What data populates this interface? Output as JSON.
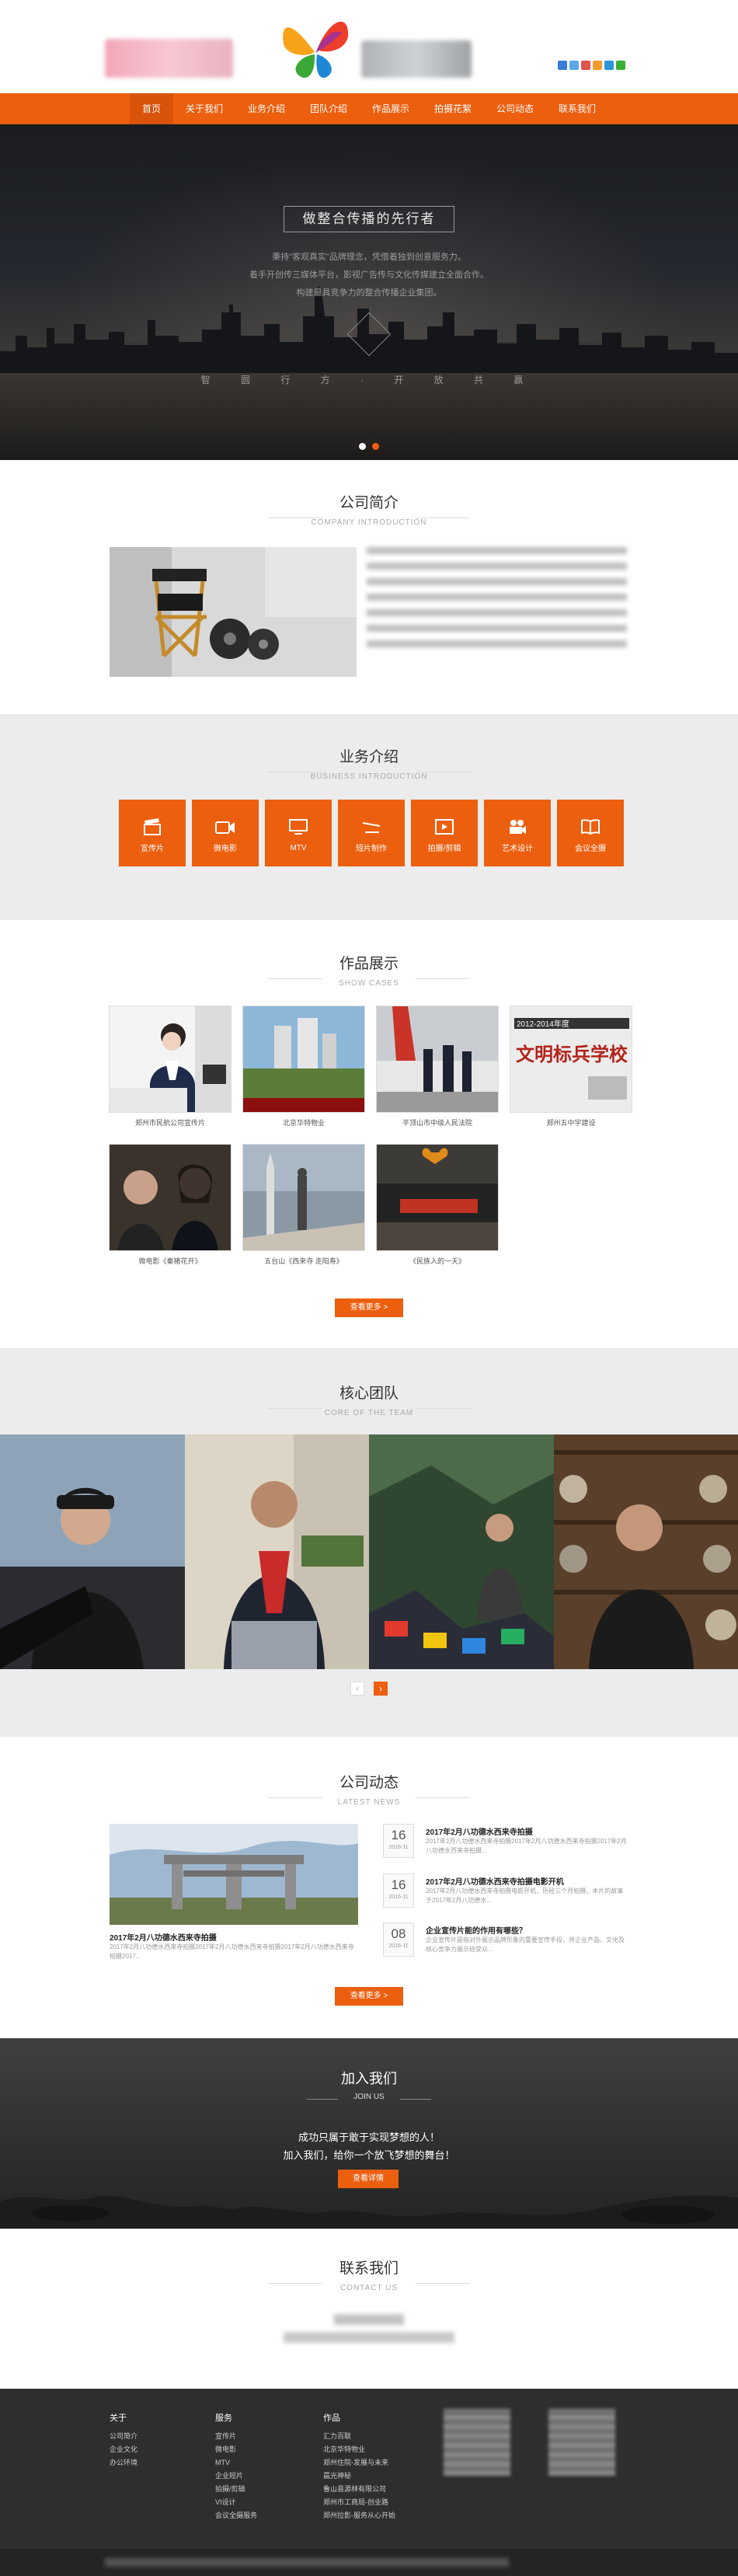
{
  "nav": [
    "首页",
    "关于我们",
    "业务介绍",
    "团队介绍",
    "作品展示",
    "拍摄花絮",
    "公司动态",
    "联系我们"
  ],
  "hero": {
    "title": "做整合传播的先行者",
    "lines": [
      "秉持\"客观真实\"品牌理念，凭借着独到创意服务力。",
      "着手开创传三媒体平台，影视广告传与文化传媒建立全面合作。",
      "构建最具竞争力的整合传播企业集团。"
    ],
    "motto": "智 圆 行 方  · 开 放 共 赢",
    "dots_active": 2
  },
  "about": {
    "title": "公司简介",
    "subtitle": "COMPANY INTRODUCTION"
  },
  "business": {
    "title": "业务介绍",
    "subtitle": "BUSINESS INTRODUCTION",
    "items": [
      {
        "label": "宣传片",
        "icon": "clapper-icon"
      },
      {
        "label": "微电影",
        "icon": "video-camera-icon"
      },
      {
        "label": "MTV",
        "icon": "monitor-icon"
      },
      {
        "label": "短片制作",
        "icon": "tripod-icon"
      },
      {
        "label": "拍摄/剪辑",
        "icon": "film-play-icon"
      },
      {
        "label": "艺术设计",
        "icon": "movie-camera-icon"
      },
      {
        "label": "会议全摄",
        "icon": "book-icon"
      }
    ]
  },
  "cases": {
    "title": "作品展示",
    "subtitle": "SHOW CASES",
    "items": [
      "郑州市民航公司宣传片",
      "北京华特物业",
      "平顶山市中级人民法院",
      "郑州五中宇建设",
      "微电影《秦猪花开》",
      "五台山《西来寺 走阳寿》",
      "《民族入的一天》"
    ],
    "banner_text": "文明标兵学校",
    "banner_year": "2012-2014年度",
    "more": "查看更多 >"
  },
  "team": {
    "title": "核心团队",
    "subtitle": "CORE OF THE TEAM"
  },
  "news": {
    "title": "公司动态",
    "subtitle": "LATEST NEWS",
    "featured_title": "2017年2月八功德水西来寺拍摄",
    "featured_summary": "2017年2月八功德水西来寺拍摄2017年2月八功德水西来寺拍摄2017年2月八功德水西来寺拍摄2017...",
    "items": [
      {
        "day": "16",
        "month": "2016-11",
        "title": "2017年2月八功德水西来寺拍摄",
        "summary": "2017年2月八功德水西来寺拍摄2017年2月八功德水西来寺拍摄2017年2月八功德水西来寺拍摄..."
      },
      {
        "day": "16",
        "month": "2016-11",
        "title": "2017年2月八功德水西来寺拍摄电影开机",
        "summary": "2017年2月八功德水西来寺拍摄电影开机，历经三个月拍摄，本片的故事于2017年2月八功德水..."
      },
      {
        "day": "08",
        "month": "2016-11",
        "title": "企业宣传片能的作用有哪些？",
        "summary": "企业宣传片是指对外展示品牌形象的重要宣传手段，将企业产品、文化及核心竞争力展示给受众..."
      }
    ],
    "more": "查看更多 >"
  },
  "join": {
    "title": "加入我们",
    "subtitle": "JOIN US",
    "line1": "成功只属于敢于实现梦想的人！",
    "line2": "加入我们，给你一个放飞梦想的舞台！",
    "button": "查看详情"
  },
  "contact": {
    "title": "联系我们",
    "subtitle": "CONTACT US"
  },
  "footer": {
    "cols": [
      {
        "head": "关于",
        "items": [
          "公司简介",
          "企业文化",
          "办公环境"
        ]
      },
      {
        "head": "服务",
        "items": [
          "宣传片",
          "微电影",
          "MTV",
          "企业短片",
          "拍摄/剪辑",
          "VI设计",
          "会议全摄服务"
        ]
      },
      {
        "head": "作品",
        "items": [
          "汇力百联",
          "北京华特物业",
          "郑州住院-发展与未来",
          "晨光神秘",
          "鲁山县源林有限公司",
          "郑州市工商局-创业路",
          "郑州拉影-服务从心开始"
        ]
      }
    ]
  },
  "colors": {
    "brand": "#ec5f0f"
  }
}
